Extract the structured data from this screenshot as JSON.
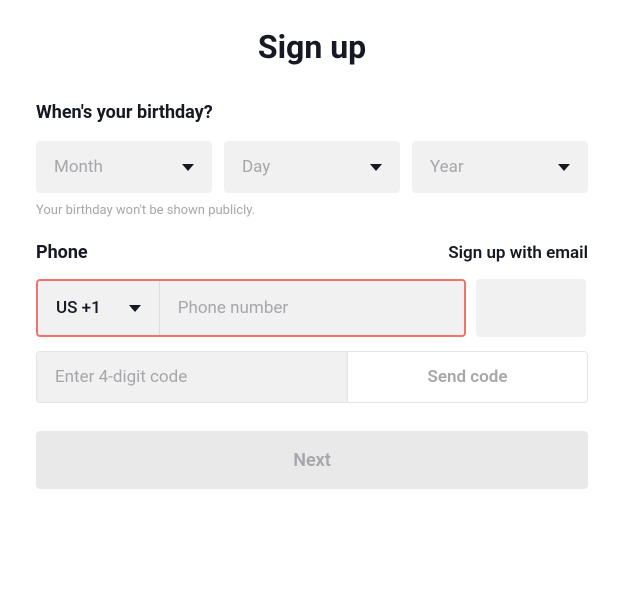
{
  "title": "Sign up",
  "birthday": {
    "label": "When's your birthday?",
    "month_placeholder": "Month",
    "day_placeholder": "Day",
    "year_placeholder": "Year",
    "hint": "Your birthday won't be shown publicly."
  },
  "phone": {
    "label": "Phone",
    "email_link": "Sign up with email",
    "country": "US +1",
    "phone_placeholder": "Phone number",
    "code_placeholder": "Enter 4-digit code",
    "send_code_label": "Send code"
  },
  "next_label": "Next"
}
